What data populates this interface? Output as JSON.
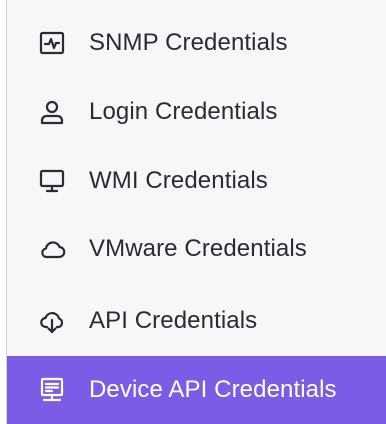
{
  "menu": {
    "items": [
      {
        "label": "SNMP Credentials",
        "icon": "activity-monitor-icon",
        "active": false
      },
      {
        "label": "Login Credentials",
        "icon": "user-icon",
        "active": false
      },
      {
        "label": "WMI Credentials",
        "icon": "monitor-icon",
        "active": false
      },
      {
        "label": "VMware Credentials",
        "icon": "cloud-icon",
        "active": false
      },
      {
        "label": "API Credentials",
        "icon": "cloud-download-icon",
        "active": false
      },
      {
        "label": "Device API Credentials",
        "icon": "server-device-icon",
        "active": true
      }
    ],
    "active_color": "#7b5ce6",
    "background_color": "#f7f7f9",
    "text_color": "#2b2b33"
  }
}
